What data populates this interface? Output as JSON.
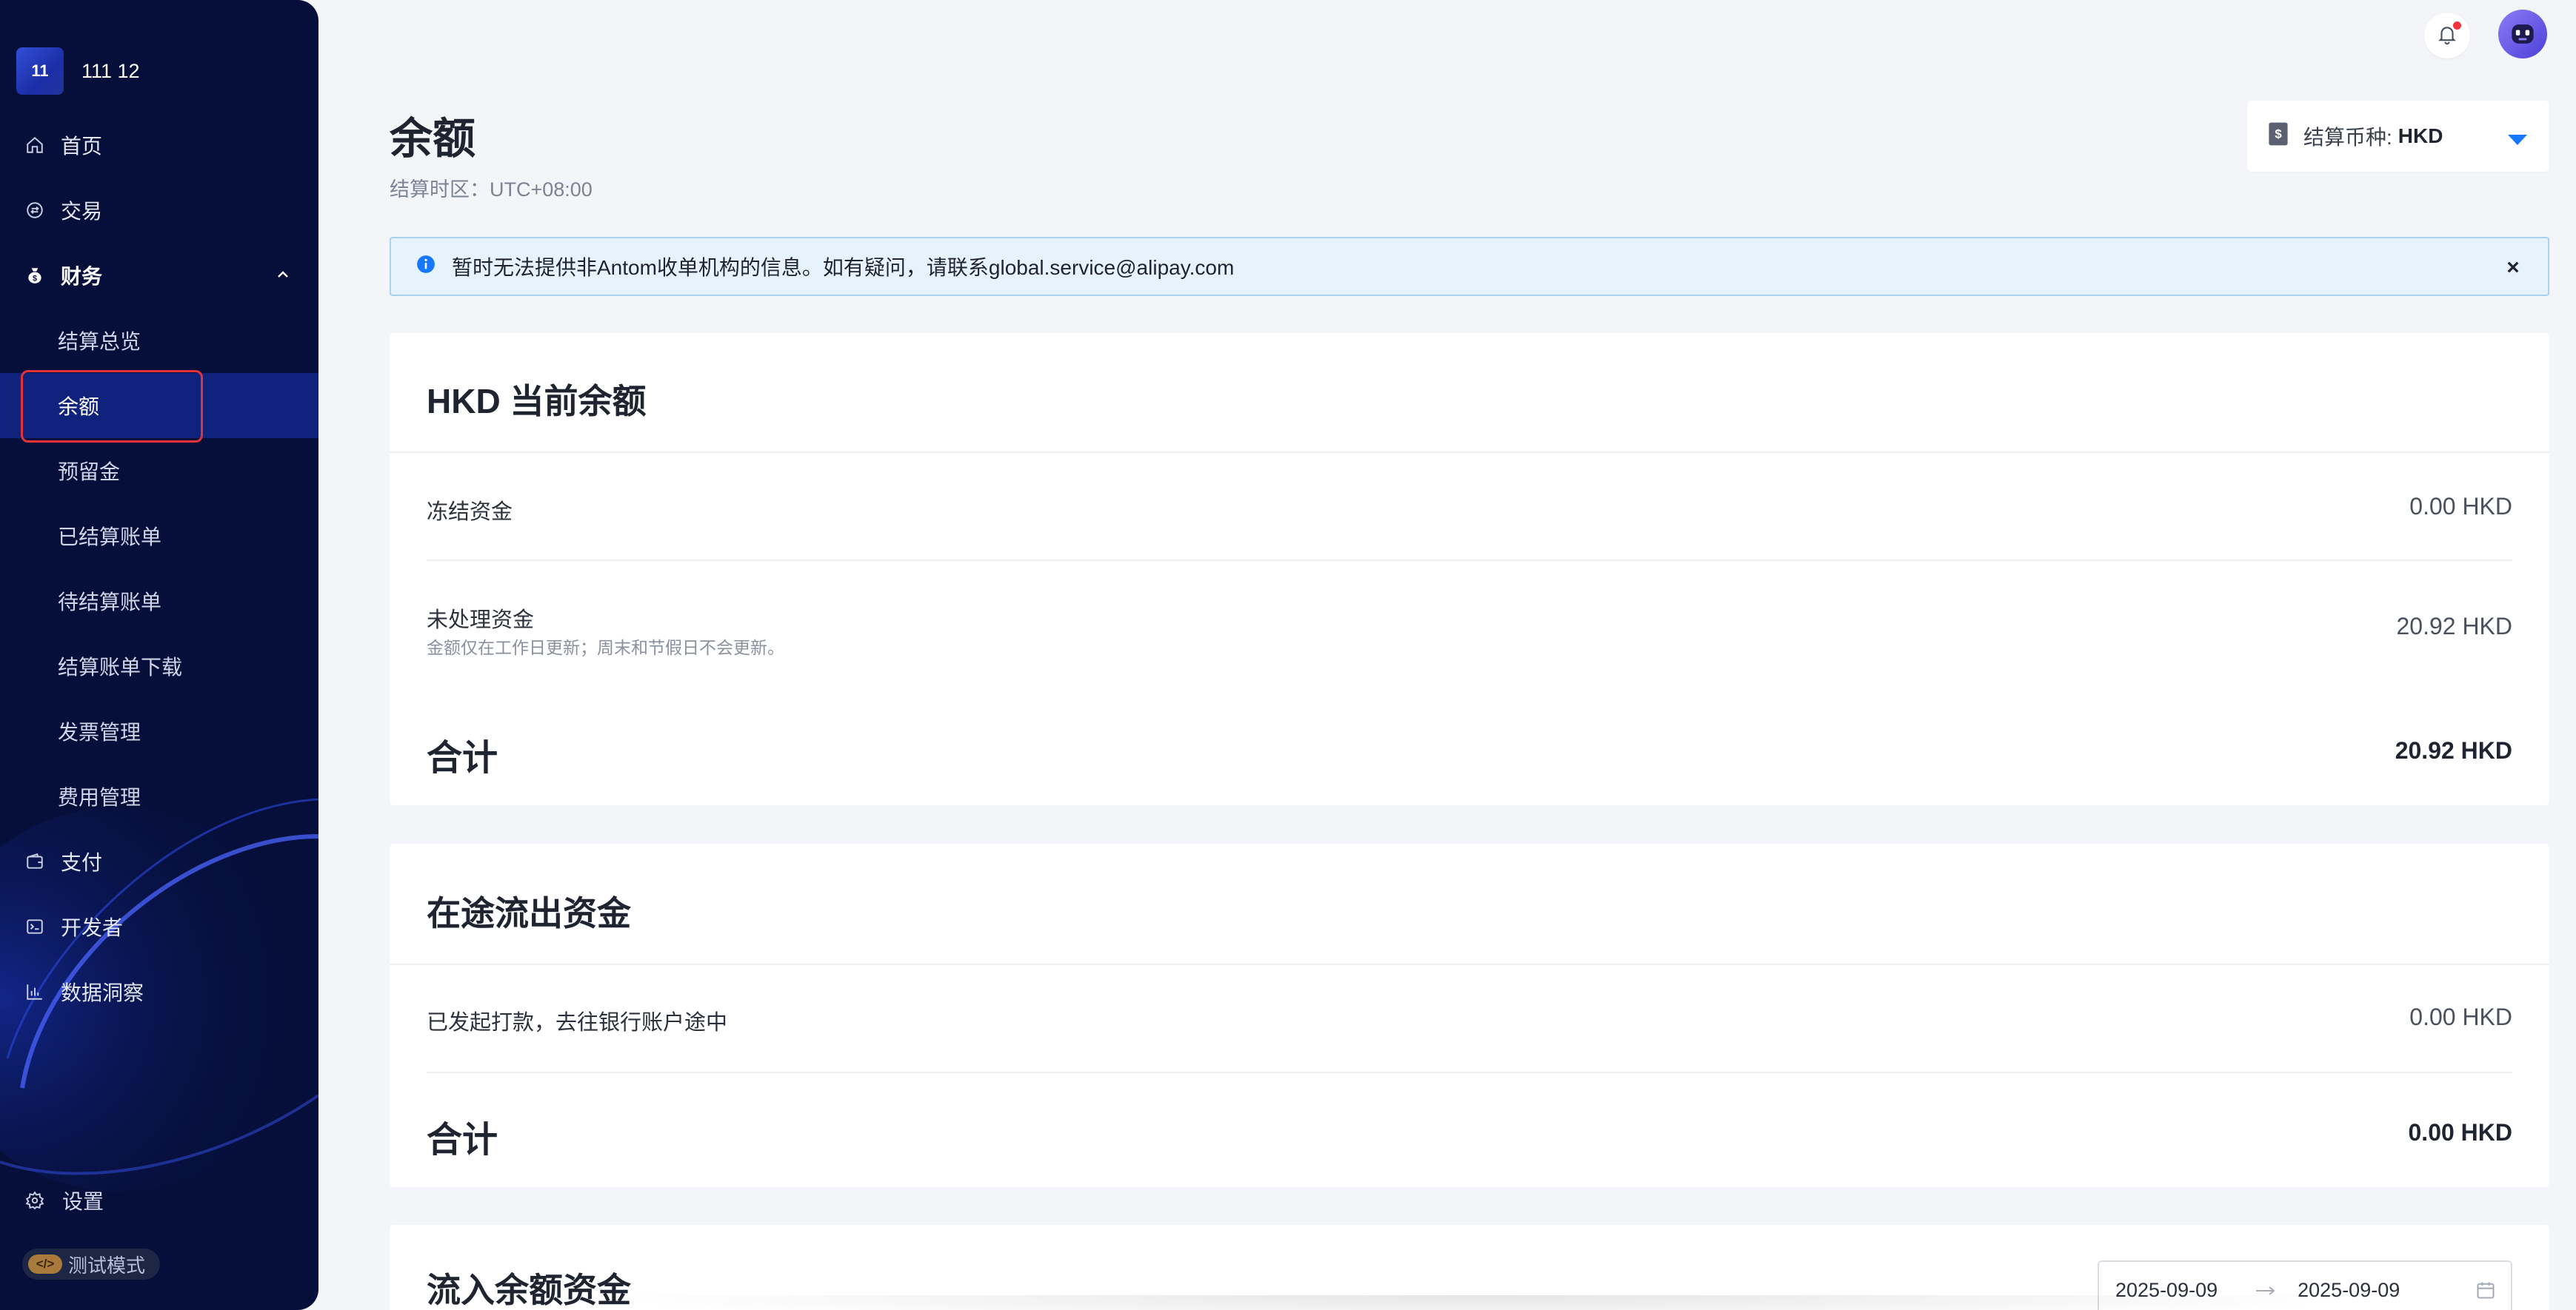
{
  "sidebar": {
    "brand": {
      "logo_text": "11",
      "name": "111 12"
    },
    "nav": {
      "home": "首页",
      "transactions": "交易",
      "finance": "财务",
      "payment": "支付",
      "developer": "开发者",
      "insights": "数据洞察"
    },
    "finance_items": {
      "settlement_overview": "结算总览",
      "balance": "余额",
      "reserve": "预留金",
      "settled_statements": "已结算账单",
      "pending_statements": "待结算账单",
      "statement_download": "结算账单下载",
      "invoice_management": "发票管理",
      "fee_management": "费用管理"
    },
    "settings": "设置",
    "test_mode": "测试模式"
  },
  "header": {
    "title": "余额",
    "timezone": "结算时区：UTC+08:00",
    "currency_label": "结算币种:",
    "currency_value": "HKD"
  },
  "alert": {
    "text": "暂时无法提供非Antom收单机构的信息。如有疑问，请联系global.service@alipay.com"
  },
  "current_balance": {
    "title": "HKD 当前余额",
    "frozen_label": "冻结资金",
    "frozen_value": "0.00 HKD",
    "unprocessed_label": "未处理资金",
    "unprocessed_note": "金额仅在工作日更新；周末和节假日不会更新。",
    "unprocessed_value": "20.92 HKD",
    "total_label": "合计",
    "total_value": "20.92 HKD"
  },
  "in_transit": {
    "title": "在途流出资金",
    "payout_label": "已发起打款，去往银行账户途中",
    "payout_value": "0.00 HKD",
    "total_label": "合计",
    "total_value": "0.00 HKD"
  },
  "inflow": {
    "title": "流入余额资金",
    "date_start": "2025-09-09",
    "date_end": "2025-09-09"
  },
  "colors": {
    "sidebar_bg": "#060f3a",
    "active_item_bg": "#10237c",
    "active_outline": "#e0323b",
    "accent": "#1677ff",
    "alert_bg": "#e6f3fc"
  }
}
